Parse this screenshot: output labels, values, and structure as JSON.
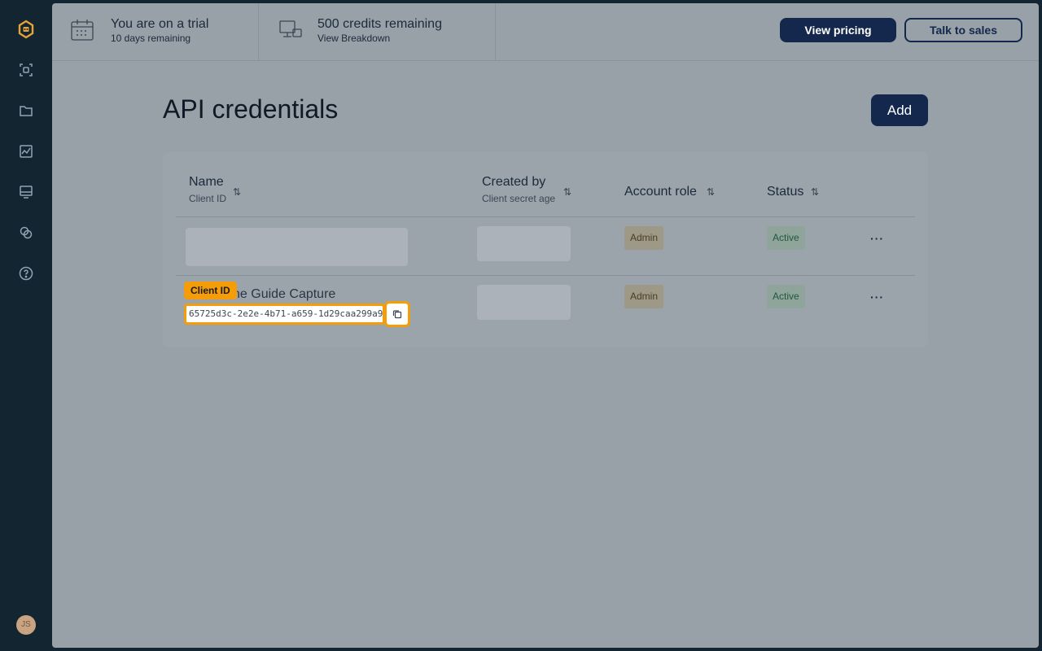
{
  "sidebar": {
    "icons": [
      "logo-icon",
      "scan-icon",
      "folder-icon",
      "chart-icon",
      "monitor-icon",
      "integrations-icon",
      "help-icon"
    ],
    "avatar_initials": "JS"
  },
  "topbar": {
    "trial_title": "You are on a trial",
    "trial_sub": "10 days remaining",
    "credits_title": "500 credits remaining",
    "credits_sub": "View Breakdown",
    "pricing_label": "View pricing",
    "sales_label": "Talk to sales"
  },
  "page": {
    "title": "API credentials",
    "add_label": "Add"
  },
  "table": {
    "columns": [
      {
        "label": "Name",
        "sub": "Client ID"
      },
      {
        "label": "Created by",
        "sub": "Client secret age"
      },
      {
        "label": "Account role",
        "sub": ""
      },
      {
        "label": "Status",
        "sub": ""
      }
    ],
    "rows": [
      {
        "name": "",
        "role": "Admin",
        "status": "Active",
        "more": "···"
      },
      {
        "name": "ne Guide Capture",
        "role": "Admin",
        "status": "Active",
        "more": "···"
      }
    ],
    "client_id_tag": "Client ID",
    "client_id_value": "65725d3c-2e2e-4b71-a659-1d29caa299a9"
  },
  "colors": {
    "sidebar_bg": "#132530",
    "primary": "#13284c",
    "highlight": "#f49d09"
  }
}
